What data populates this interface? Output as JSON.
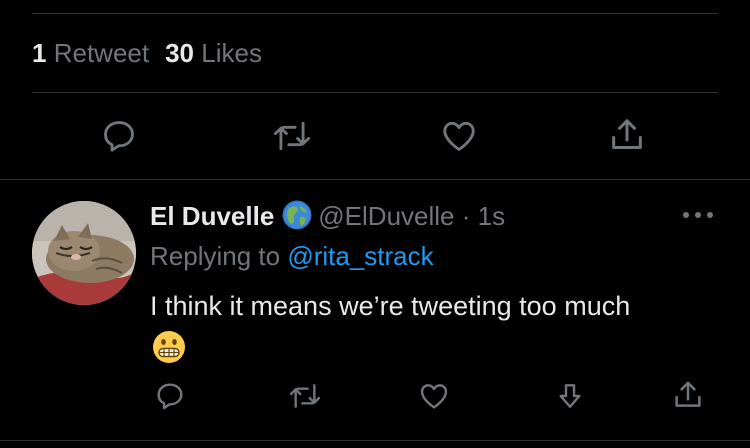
{
  "stats": {
    "retweet_count": "1",
    "retweet_label": "Retweet",
    "like_count": "30",
    "like_label": "Likes"
  },
  "main_actions": [
    "reply-icon",
    "retweet-icon",
    "like-icon",
    "share-icon"
  ],
  "reply_tweet": {
    "display_name": "El Duvelle",
    "badge_icon": "globe-emoji",
    "handle": "@ElDuvelle",
    "separator": "·",
    "time": "1s",
    "replying_prefix": "Replying to",
    "replying_to": "@rita_strack",
    "text": "I think it means we’re tweeting too much",
    "emoji": "grimacing-face-emoji",
    "actions": [
      "reply-icon",
      "retweet-icon",
      "like-icon",
      "downvote-icon",
      "share-icon"
    ]
  },
  "colors": {
    "background": "#000000",
    "text": "#e7e9ea",
    "muted": "#71767b",
    "link": "#1d9bf0",
    "divider": "#2f3336"
  }
}
